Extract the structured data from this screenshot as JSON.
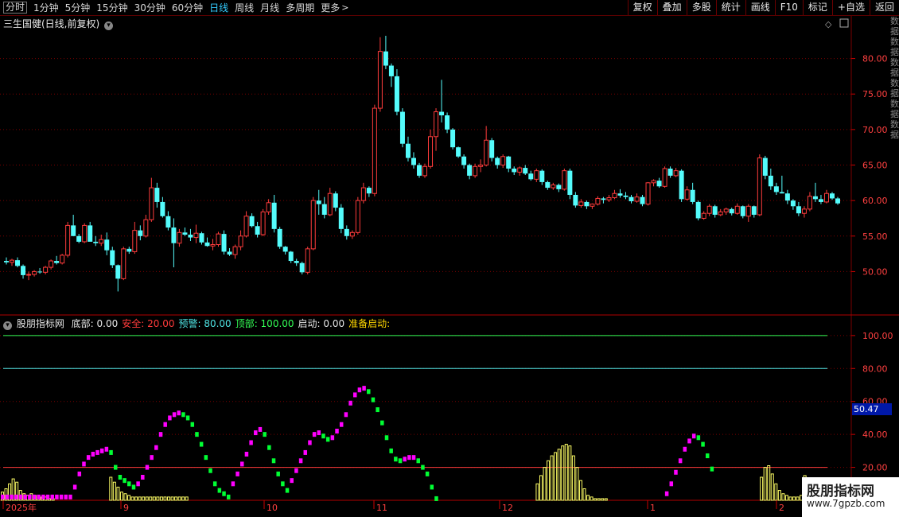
{
  "toolbar": {
    "periods": [
      {
        "label": "分时",
        "active": false,
        "frame": true
      },
      {
        "label": "1分钟",
        "active": false,
        "frame": false
      },
      {
        "label": "5分钟",
        "active": false,
        "frame": false
      },
      {
        "label": "15分钟",
        "active": false,
        "frame": false
      },
      {
        "label": "30分钟",
        "active": false,
        "frame": false
      },
      {
        "label": "60分钟",
        "active": false,
        "frame": false
      },
      {
        "label": "日线",
        "active": true,
        "frame": false
      },
      {
        "label": "周线",
        "active": false,
        "frame": false
      },
      {
        "label": "月线",
        "active": false,
        "frame": false
      },
      {
        "label": "多周期",
        "active": false,
        "frame": false
      },
      {
        "label": "更多",
        "active": false,
        "frame": false
      }
    ],
    "tools": [
      "复权",
      "叠加",
      "多股",
      "统计",
      "画线",
      "F10",
      "标记",
      "+自选",
      "返回"
    ]
  },
  "stock": {
    "title": "三生国健(日线,前复权)"
  },
  "indicator": {
    "name": "股朋指标网",
    "items": [
      {
        "label": "底部: 0.00",
        "color": "#e6e6e6"
      },
      {
        "label": "安全: 20.00",
        "color": "#ff3b3b"
      },
      {
        "label": "预警: 80.00",
        "color": "#4fe3e3"
      },
      {
        "label": "顶部: 100.00",
        "color": "#33ff55"
      },
      {
        "label": "启动: 0.00",
        "color": "#e6e6e6"
      },
      {
        "label": "准备启动:",
        "color": "#ffd700"
      }
    ],
    "current_value": "50.47"
  },
  "watermark": {
    "title": "股朋指标网",
    "url": "www.7gpzb.com"
  },
  "right_edge_chars": "数据数据数据数据数据数据",
  "colors": {
    "up": "#ff3c3c",
    "down": "#54fcfc",
    "grid": "#7a0000",
    "magenta": "#ff00ff",
    "green": "#00ff33",
    "yellow": "#ffff66"
  },
  "chart_data": [
    {
      "type": "candlestick",
      "title": "三生国健(日线,前复权)",
      "ylim": [
        44,
        86
      ],
      "y_ticks": [
        50,
        55,
        60,
        65,
        70,
        75,
        80
      ],
      "x_tick_labels": [
        "2025年",
        "9",
        "10",
        "11",
        "12",
        "1",
        "2"
      ],
      "ohlc": [
        [
          51.5,
          52,
          51,
          51.3
        ],
        [
          51.3,
          51.8,
          50.8,
          51.6
        ],
        [
          51.6,
          52,
          50.6,
          50.8
        ],
        [
          50.8,
          51,
          49,
          49.5
        ],
        [
          49.5,
          50,
          48.8,
          49.6
        ],
        [
          49.6,
          50.2,
          49.3,
          50
        ],
        [
          50,
          50.5,
          49.7,
          49.9
        ],
        [
          49.9,
          50.8,
          49.6,
          50.6
        ],
        [
          50.6,
          51.7,
          50.3,
          51.5
        ],
        [
          51.5,
          52.2,
          51,
          51.2
        ],
        [
          51.2,
          52.5,
          51,
          52.3
        ],
        [
          52.3,
          57,
          52,
          56.5
        ],
        [
          56.5,
          58,
          55,
          55
        ],
        [
          55,
          55.3,
          54,
          54.2
        ],
        [
          54.2,
          56.8,
          54,
          56.5
        ],
        [
          56.5,
          57,
          54.5,
          54.2
        ],
        [
          54.2,
          55,
          53.6,
          54
        ],
        [
          54,
          55.2,
          53.6,
          54.5
        ],
        [
          54.5,
          55.5,
          52.3,
          53
        ],
        [
          53,
          53.5,
          50.5,
          50.9
        ],
        [
          50.9,
          51,
          47.2,
          49
        ],
        [
          49,
          53.5,
          48.8,
          53.2
        ],
        [
          53.2,
          53.5,
          52.5,
          52.8
        ],
        [
          52.8,
          57,
          52.5,
          55.8
        ],
        [
          55.8,
          56.5,
          54.4,
          55
        ],
        [
          55,
          58,
          54.8,
          57.3
        ],
        [
          57.3,
          63.2,
          57,
          61.8
        ],
        [
          61.8,
          62.5,
          59,
          59.8
        ],
        [
          59.8,
          60.5,
          57.6,
          57.8
        ],
        [
          57.8,
          58.5,
          55.8,
          56.2
        ],
        [
          56.2,
          57.5,
          50.6,
          54
        ],
        [
          54,
          56,
          53.5,
          55.5
        ],
        [
          55.5,
          56.2,
          55,
          55.2
        ],
        [
          55.2,
          56,
          54.3,
          54.8
        ],
        [
          54.8,
          56.6,
          54,
          55.4
        ],
        [
          55.4,
          55.6,
          53.8,
          54.1
        ],
        [
          54.1,
          54.8,
          53.5,
          53.6
        ],
        [
          53.6,
          54.6,
          53,
          53.8
        ],
        [
          53.8,
          55.6,
          53.5,
          55.3
        ],
        [
          55.3,
          55.8,
          52.4,
          52.8
        ],
        [
          52.8,
          53.3,
          52.2,
          52.4
        ],
        [
          52.4,
          53.8,
          51.8,
          53.5
        ],
        [
          53.5,
          55.8,
          53,
          55
        ],
        [
          55,
          58.5,
          54.8,
          57.8
        ],
        [
          57.8,
          58.2,
          56.2,
          56.4
        ],
        [
          56.4,
          57,
          54.8,
          55.2
        ],
        [
          55.2,
          58.8,
          55,
          58.4
        ],
        [
          58.4,
          60.2,
          58,
          59.7
        ],
        [
          59.7,
          60.8,
          55.5,
          56
        ],
        [
          56,
          56.3,
          53.2,
          53.5
        ],
        [
          53.5,
          53.6,
          52.4,
          52.8
        ],
        [
          52.8,
          52.9,
          51.2,
          51.5
        ],
        [
          51.5,
          51.8,
          50.8,
          51.2
        ],
        [
          51.2,
          51.4,
          49.6,
          49.9
        ],
        [
          49.9,
          53.5,
          49.6,
          53.2
        ],
        [
          53.2,
          60.5,
          53,
          60
        ],
        [
          60,
          61.5,
          58,
          59.5
        ],
        [
          59.5,
          60.5,
          57.5,
          58
        ],
        [
          58,
          61.8,
          57.8,
          61
        ],
        [
          61,
          61.3,
          58.5,
          59
        ],
        [
          59,
          59.5,
          55.4,
          56
        ],
        [
          56,
          56.5,
          54.5,
          55
        ],
        [
          55,
          55.8,
          54.6,
          55.5
        ],
        [
          55.5,
          60.5,
          55.2,
          60
        ],
        [
          60,
          62.5,
          59.6,
          61.8
        ],
        [
          61.8,
          62,
          60.5,
          61
        ],
        [
          61,
          73.5,
          60.6,
          73
        ],
        [
          73,
          83,
          72.5,
          81
        ],
        [
          81,
          83.2,
          78.5,
          79
        ],
        [
          79,
          79.3,
          76,
          77.5
        ],
        [
          77.5,
          78.5,
          72,
          72.5
        ],
        [
          72.5,
          73,
          67.5,
          68
        ],
        [
          68,
          69,
          65.5,
          66
        ],
        [
          66,
          66.8,
          64.5,
          65
        ],
        [
          65,
          65.3,
          63.2,
          63.5
        ],
        [
          63.5,
          65.2,
          63.2,
          64.8
        ],
        [
          64.8,
          70,
          64.5,
          69
        ],
        [
          69,
          73,
          67,
          72.5
        ],
        [
          72.5,
          77,
          71,
          72
        ],
        [
          72,
          72.4,
          69.5,
          70
        ],
        [
          70,
          70.2,
          67.2,
          67.5
        ],
        [
          67.5,
          67.6,
          66,
          66.2
        ],
        [
          66.2,
          66.5,
          64.5,
          65
        ],
        [
          65,
          65.2,
          63,
          63.5
        ],
        [
          63.5,
          65.2,
          63.2,
          64.8
        ],
        [
          64.8,
          65.8,
          64,
          65
        ],
        [
          65,
          70.5,
          64.8,
          68.5
        ],
        [
          68.5,
          68.8,
          65.5,
          66
        ],
        [
          66,
          66.2,
          64.5,
          65
        ],
        [
          65,
          66.5,
          64.6,
          66.2
        ],
        [
          66.2,
          66.3,
          64,
          64.5
        ],
        [
          64.5,
          64.8,
          63.6,
          64
        ],
        [
          64,
          64.8,
          63.5,
          64.6
        ],
        [
          64.6,
          65,
          63.6,
          63.8
        ],
        [
          63.8,
          64.2,
          62.8,
          63
        ],
        [
          63,
          64.5,
          62.6,
          64.2
        ],
        [
          64.2,
          64.4,
          62.2,
          62.6
        ],
        [
          62.6,
          62.8,
          61.5,
          61.8
        ],
        [
          61.8,
          62.5,
          61.5,
          62.2
        ],
        [
          62.2,
          62.4,
          61.2,
          61.6
        ],
        [
          61.6,
          64.5,
          61.4,
          64.2
        ],
        [
          64.2,
          64.5,
          60.2,
          60.8
        ],
        [
          60.8,
          61.2,
          59,
          59.3
        ],
        [
          59.3,
          60.2,
          59,
          59.8
        ],
        [
          59.8,
          60,
          58.8,
          59.2
        ],
        [
          59.2,
          59.6,
          58.8,
          59.5
        ],
        [
          59.5,
          60.6,
          59.3,
          60.3
        ],
        [
          60.3,
          60.5,
          59.6,
          60.1
        ],
        [
          60.1,
          60.8,
          59.8,
          60.4
        ],
        [
          60.4,
          61.5,
          60.2,
          61
        ],
        [
          61,
          61.6,
          60.4,
          60.7
        ],
        [
          60.7,
          61.2,
          60.2,
          60.5
        ],
        [
          60.5,
          60.8,
          59.6,
          59.9
        ],
        [
          59.9,
          61,
          59.7,
          60.5
        ],
        [
          60.5,
          60.8,
          59.2,
          59.5
        ],
        [
          59.5,
          62.6,
          59.3,
          62.5
        ],
        [
          62.5,
          63,
          62,
          62.8
        ],
        [
          62.8,
          63.2,
          61.8,
          62
        ],
        [
          62,
          64.8,
          61.8,
          64.5
        ],
        [
          64.5,
          64.8,
          63.2,
          63.5
        ],
        [
          63.5,
          64.6,
          63.3,
          64.2
        ],
        [
          64.2,
          64.4,
          59.8,
          60.2
        ],
        [
          60.2,
          62,
          60,
          61.5
        ],
        [
          61.5,
          62.5,
          59.5,
          59.8
        ],
        [
          59.8,
          60,
          57.2,
          57.5
        ],
        [
          57.5,
          58.5,
          57.3,
          58.2
        ],
        [
          58.2,
          59.5,
          57.8,
          59.2
        ],
        [
          59.2,
          59.4,
          57.6,
          58
        ],
        [
          58,
          58.8,
          57.8,
          58.4
        ],
        [
          58.4,
          59,
          58,
          58.8
        ],
        [
          58.8,
          59,
          57.9,
          58.2
        ],
        [
          58.2,
          59.6,
          58,
          59.2
        ],
        [
          59.2,
          59.3,
          57.5,
          57.8
        ],
        [
          57.8,
          59.5,
          57,
          59.2
        ],
        [
          59.2,
          59.3,
          57.6,
          58
        ],
        [
          58,
          66.5,
          57.8,
          66
        ],
        [
          66,
          66.3,
          63,
          63.5
        ],
        [
          63.5,
          64.5,
          61.5,
          62
        ],
        [
          62,
          62.5,
          60.8,
          61.2
        ],
        [
          61.2,
          63.5,
          61,
          61
        ],
        [
          61,
          61.5,
          59.5,
          60
        ],
        [
          60,
          60.2,
          58.7,
          59.2
        ],
        [
          59.2,
          59.8,
          57.8,
          58.2
        ],
        [
          58.2,
          59.2,
          57.6,
          58.8
        ],
        [
          58.8,
          61.2,
          58.5,
          60.6
        ],
        [
          60.6,
          62.5,
          59.8,
          60.2
        ],
        [
          60.2,
          60.8,
          59.5,
          59.8
        ],
        [
          59.8,
          61.5,
          59.6,
          61
        ],
        [
          61,
          61.2,
          60.1,
          60.3
        ],
        [
          60.3,
          60.5,
          59.4,
          59.6
        ]
      ]
    },
    {
      "type": "indicator",
      "name": "股朋指标网",
      "ylim": [
        0,
        112
      ],
      "y_ticks": [
        20,
        40,
        60,
        80,
        100
      ],
      "levels": {
        "bottom": 0,
        "safe": 20,
        "warning": 80,
        "top": 100,
        "start": 0
      },
      "series_values": [
        2,
        2,
        2,
        2,
        2,
        2,
        2,
        2,
        2,
        2,
        2,
        2,
        2,
        2,
        2,
        2,
        8,
        16,
        22,
        26,
        28,
        29,
        30,
        31,
        29,
        20,
        14,
        12,
        10,
        8,
        10,
        14,
        20,
        26,
        32,
        40,
        46,
        50,
        52,
        53,
        52,
        50,
        46,
        40,
        34,
        26,
        18,
        10,
        6,
        4,
        2,
        10,
        16,
        22,
        28,
        35,
        41,
        43,
        40,
        32,
        24,
        16,
        10,
        6,
        12,
        18,
        24,
        29,
        35,
        40,
        41,
        39,
        37,
        38,
        42,
        46,
        52,
        59,
        64,
        67,
        68,
        66,
        61,
        55,
        47,
        38,
        30,
        25,
        24,
        25,
        26,
        26,
        24,
        20,
        16,
        8,
        1,
        0,
        0,
        0,
        0,
        0,
        0,
        0,
        0,
        0,
        0,
        0,
        0,
        0,
        0,
        0,
        0,
        0,
        0,
        0,
        0,
        0,
        0,
        0,
        0,
        0,
        0,
        0,
        0,
        0,
        0,
        0,
        0,
        0,
        0,
        0,
        0,
        0,
        0,
        0,
        0,
        0,
        0,
        0,
        0,
        0,
        0,
        0,
        0,
        0,
        0,
        4,
        10,
        17,
        24,
        31,
        36,
        39,
        38,
        34,
        27,
        19,
        0,
        0,
        0,
        0,
        0,
        0,
        0,
        0,
        0,
        0,
        0,
        0,
        0,
        0,
        0,
        0,
        0,
        0,
        0,
        0,
        0,
        0,
        0,
        0,
        0,
        0,
        0
      ],
      "yellow_values": [
        5,
        7,
        10,
        13,
        11,
        6,
        4,
        3,
        4,
        3,
        2,
        2,
        2,
        1,
        1,
        0,
        0,
        0,
        0,
        0,
        0,
        0,
        0,
        0,
        0,
        0,
        0,
        0,
        0,
        0,
        14,
        11,
        8,
        5,
        4,
        3,
        2,
        2,
        2,
        2,
        2,
        2,
        2,
        2,
        2,
        2,
        2,
        2,
        2,
        2,
        2,
        2,
        0,
        0,
        0,
        0,
        0,
        0,
        0,
        0,
        0,
        0,
        0,
        0,
        0,
        0,
        0,
        0,
        0,
        0,
        0,
        0,
        0,
        0,
        0,
        0,
        0,
        0,
        0,
        0,
        0,
        0,
        0,
        0,
        0,
        0,
        0,
        0,
        0,
        0,
        0,
        0,
        0,
        0,
        0,
        0,
        0,
        0,
        0,
        0,
        0,
        0,
        0,
        0,
        0,
        0,
        0,
        0,
        0,
        0,
        0,
        0,
        0,
        0,
        0,
        0,
        0,
        0,
        0,
        0,
        0,
        0,
        0,
        0,
        0,
        0,
        0,
        0,
        0,
        0,
        0,
        0,
        0,
        0,
        0,
        0,
        0,
        0,
        0,
        0,
        0,
        0,
        0,
        0,
        0,
        0,
        0,
        0,
        10,
        15,
        20,
        24,
        27,
        29,
        31,
        33,
        34,
        33,
        27,
        20,
        12,
        7,
        3,
        2,
        1,
        1,
        1,
        1,
        0,
        0,
        0,
        0,
        0,
        0,
        0,
        0,
        0,
        0,
        0,
        0,
        0,
        0,
        0,
        0,
        0,
        0,
        0,
        0,
        0,
        0,
        0,
        0,
        0,
        0,
        0,
        0,
        0,
        0,
        0,
        0,
        0,
        0,
        0,
        0,
        0,
        0,
        0,
        0,
        0,
        0,
        14,
        20,
        21,
        16,
        10,
        6,
        4,
        3,
        2,
        2,
        2,
        3,
        15,
        12,
        8,
        5,
        3,
        2,
        1,
        1,
        1
      ]
    }
  ]
}
